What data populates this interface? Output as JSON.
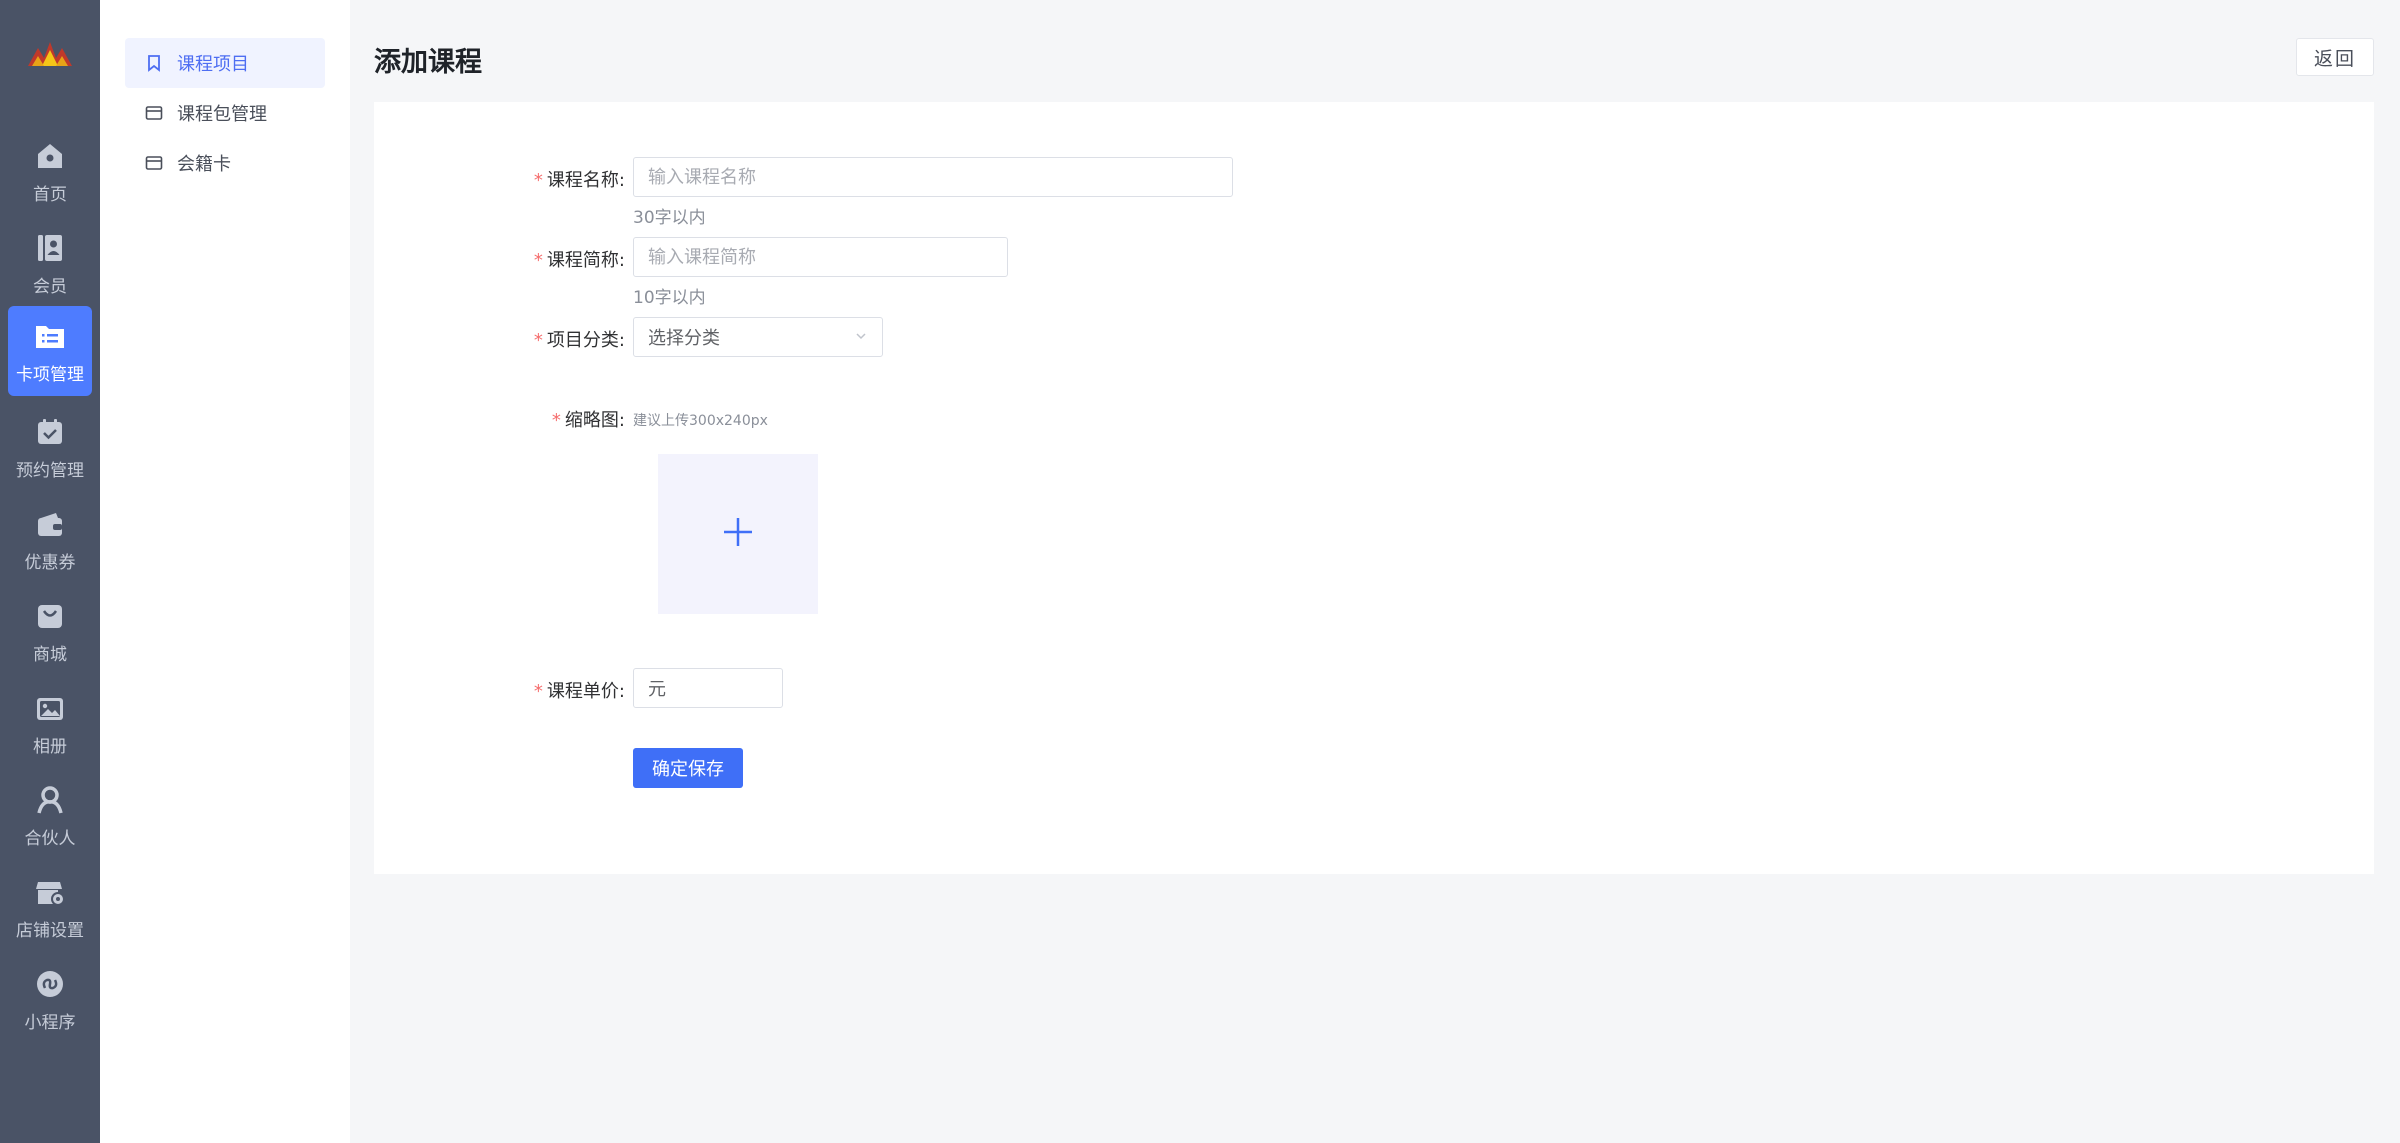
{
  "rail": {
    "items": [
      {
        "label": "首页",
        "icon": "home-icon"
      },
      {
        "label": "会员",
        "icon": "member-icon"
      },
      {
        "label": "卡项管理",
        "icon": "card-folder-icon",
        "active": true
      },
      {
        "label": "预约管理",
        "icon": "calendar-check-icon"
      },
      {
        "label": "优惠券",
        "icon": "wallet-icon"
      },
      {
        "label": "商城",
        "icon": "shopping-bag-icon"
      },
      {
        "label": "相册",
        "icon": "album-icon"
      },
      {
        "label": "合伙人",
        "icon": "partner-icon"
      },
      {
        "label": "店铺设置",
        "icon": "shop-settings-icon"
      },
      {
        "label": "小程序",
        "icon": "miniprogram-icon"
      }
    ]
  },
  "subnav": {
    "items": [
      {
        "label": "课程项目",
        "icon": "bookmark-icon",
        "active": true
      },
      {
        "label": "课程包管理",
        "icon": "card-icon"
      },
      {
        "label": "会籍卡",
        "icon": "card-icon"
      }
    ]
  },
  "header": {
    "title": "添加课程",
    "back_label": "返回"
  },
  "form": {
    "required_mark": "*",
    "course_name": {
      "label": "课程名称:",
      "placeholder": "输入课程名称",
      "hint": "30字以内"
    },
    "course_short": {
      "label": "课程简称:",
      "placeholder": "输入课程简称",
      "hint": "10字以内"
    },
    "category": {
      "label": "项目分类:",
      "value": "选择分类"
    },
    "thumbnail": {
      "label": "缩略图:",
      "hint": "建议上传300x240px"
    },
    "price": {
      "label": "课程单价:",
      "unit": "元"
    },
    "save_label": "确定保存"
  },
  "colors": {
    "rail_bg": "#4a5366",
    "accent": "#4e7cff",
    "primary_button": "#3f6ff7",
    "required": "#f56c6c"
  }
}
